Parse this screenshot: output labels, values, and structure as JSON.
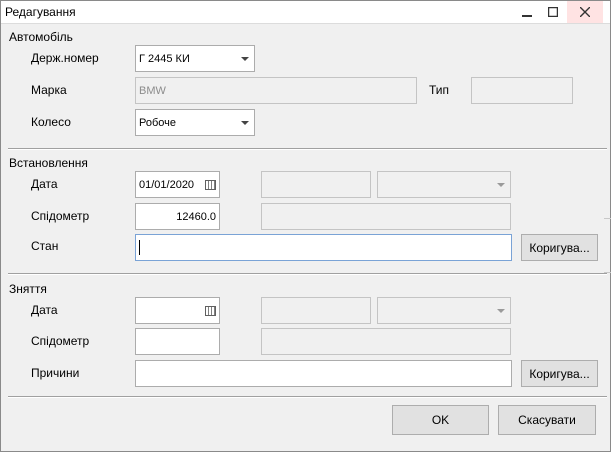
{
  "window": {
    "title": "Редагування"
  },
  "auto": {
    "group_label": "Автомобіль",
    "plate_label": "Держ.номер",
    "plate_value": "Г 2445 КИ",
    "brand_label": "Марка",
    "brand_value": "BMW",
    "type_label": "Тип",
    "type_value": "",
    "wheel_label": "Колесо",
    "wheel_value": "Робоче"
  },
  "install": {
    "group_label": "Встановлення",
    "date_label": "Дата",
    "date_value": "01/01/2020",
    "speedo_label": "Спідометр",
    "speedo_value": "12460.0",
    "state_label": "Стан",
    "state_value": "",
    "edit_button": "Коригува..."
  },
  "removal": {
    "group_label": "Зняття",
    "date_label": "Дата",
    "date_value": "",
    "speedo_label": "Спідометр",
    "speedo_value": "",
    "reasons_label": "Причини",
    "reasons_value": "",
    "edit_button": "Коригува..."
  },
  "footer": {
    "ok": "OK",
    "cancel": "Скасувати"
  }
}
